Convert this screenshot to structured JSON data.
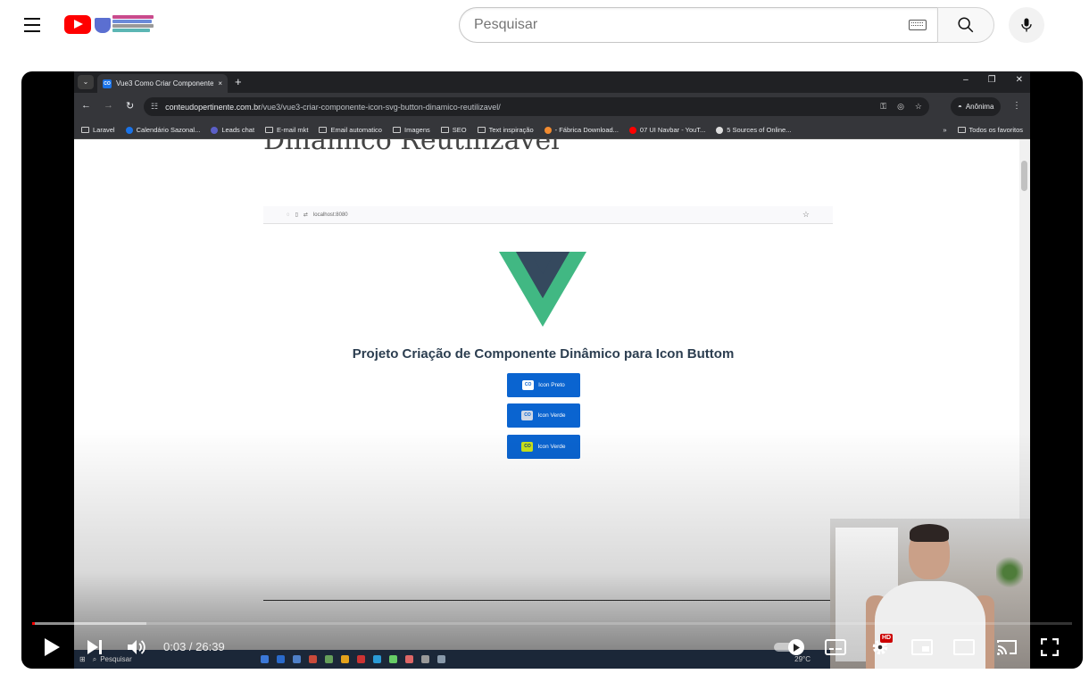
{
  "masthead": {
    "search_placeholder": "Pesquisar",
    "icons": [
      "menu-icon",
      "youtube-logo",
      "keyboard-icon",
      "search-icon",
      "mic-icon"
    ]
  },
  "video": {
    "chrome": {
      "tab_title": "Vue3 Como Criar Componente",
      "tab_close": "×",
      "new_tab": "+",
      "url_host": "conteudopertinente.com.br",
      "url_path": "/vue3/vue3-criar-componente-icon-svg-button-dinamico-reutilizavel/",
      "incognito_label": "Anônima",
      "bookmarks": [
        {
          "label": "Laravel",
          "color": ""
        },
        {
          "label": "Calendário Sazonal...",
          "color": "#1a73e8"
        },
        {
          "label": "Leads chat",
          "color": "#5b5fc7"
        },
        {
          "label": "E-mail mkt",
          "color": ""
        },
        {
          "label": "Email automatico",
          "color": ""
        },
        {
          "label": "Imagens",
          "color": ""
        },
        {
          "label": "SEO",
          "color": ""
        },
        {
          "label": "Text inspiração",
          "color": ""
        },
        {
          "label": "- Fábrica Download...",
          "color": "#f28b30"
        },
        {
          "label": "07 UI Navbar - YouT...",
          "color": "#ff0000"
        },
        {
          "label": "5 Sources of Online...",
          "color": "#dddddd"
        }
      ],
      "bookmarks_overflow": "»",
      "all_bookmarks": "Todos os favoritos"
    },
    "page": {
      "heading": "Dinâmico Reutilizável",
      "inner_url": "localhost:8080",
      "project_title": "Projeto Criação de Componente Dinâmico para Icon Buttom",
      "buttons": [
        {
          "label": "Icon Preto",
          "badge": "CO",
          "badge_bg": "#ffffff",
          "badge_fg": "#0a64d0"
        },
        {
          "label": "Icon Verde",
          "badge": "CO",
          "badge_bg": "#cfd8e6",
          "badge_fg": "#0a64d0"
        },
        {
          "label": "Icon Verde",
          "badge": "CO",
          "badge_bg": "#c9e21b",
          "badge_fg": "#0a3f7a"
        }
      ]
    },
    "taskbar": {
      "search_label": "Pesquisar",
      "temperature": "29°C"
    },
    "player": {
      "time_display": "0:03 / 26:39",
      "hd_badge": "HD",
      "played_fraction": 0.0019,
      "loaded_fraction": 0.11,
      "accent": "#ff0000"
    }
  }
}
